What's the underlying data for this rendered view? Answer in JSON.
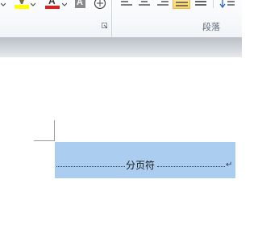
{
  "ribbon": {
    "font_group": {
      "highlight_color": "#ffff00",
      "font_color": "#e41b1b",
      "char_shading_letter": "A",
      "enclose_char_symbol": "字",
      "icons": [
        "highlight-icon",
        "font-color-icon",
        "character-shading-icon",
        "enclose-characters-icon",
        "dialog-launcher-icon"
      ]
    },
    "paragraph_group": {
      "label": "段落",
      "icons": [
        "align-left-icon",
        "align-center-icon",
        "align-right-icon",
        "justify-icon",
        "distributed-icon",
        "line-spacing-icon"
      ],
      "active": "justify"
    }
  },
  "document": {
    "page_break_text": "分页符",
    "paragraph_mark": "↵",
    "selection_color": "#abcdf0"
  }
}
